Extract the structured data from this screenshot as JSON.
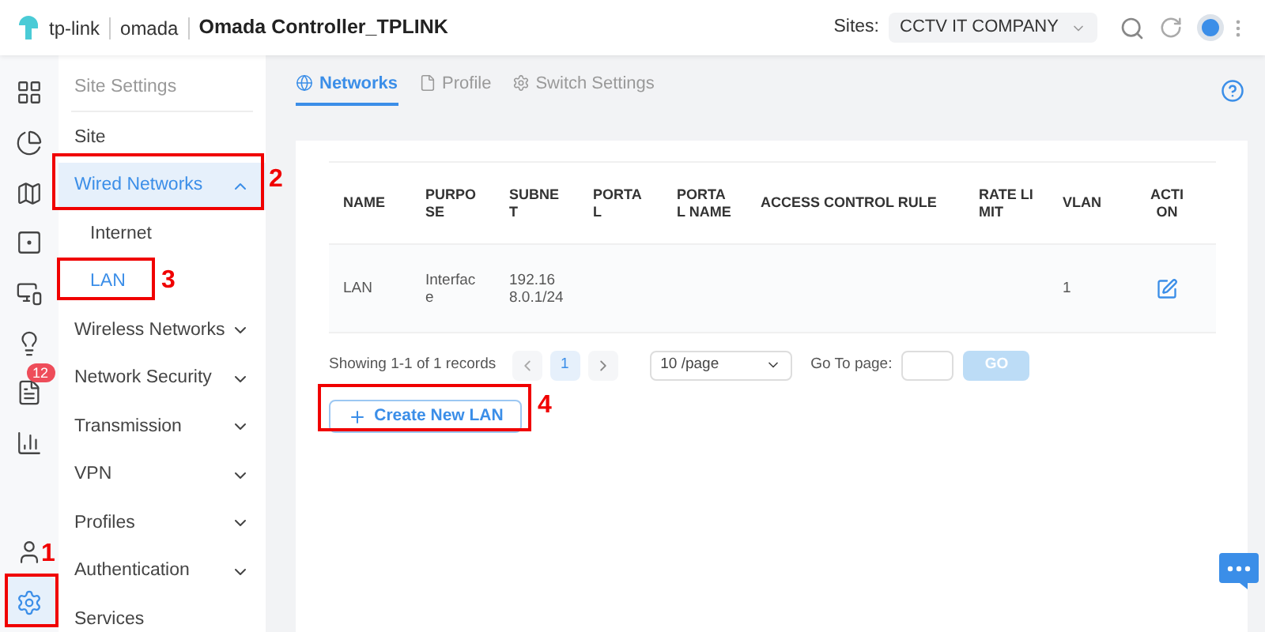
{
  "header": {
    "brand": "tp-link",
    "product": "omada",
    "title": "Omada Controller_TPLINK",
    "sites_label": "Sites:",
    "site": "CCTV IT COMPANY"
  },
  "rail": [
    {
      "kind": "apps",
      "selected": false
    },
    {
      "kind": "chart",
      "selected": false
    },
    {
      "kind": "map",
      "selected": false
    },
    {
      "kind": "device",
      "selected": false
    },
    {
      "kind": "clients",
      "selected": false
    },
    {
      "kind": "insight",
      "selected": false
    },
    {
      "kind": "log",
      "selected": false,
      "badge": "12"
    },
    {
      "kind": "stats",
      "selected": false
    },
    {
      "kind": "account",
      "selected": false
    },
    {
      "kind": "settings",
      "selected": true
    }
  ],
  "sidebar": {
    "heading": "Site Settings",
    "items": [
      {
        "label": "Site",
        "selected": false
      },
      {
        "label": "Wired Networks",
        "selected": true,
        "expanded": true,
        "children": [
          {
            "label": "Internet",
            "selected": false
          },
          {
            "label": "LAN",
            "selected": true
          }
        ]
      },
      {
        "label": "Wireless Networks",
        "selected": false,
        "expanded": false
      },
      {
        "label": "Network Security",
        "selected": false,
        "expanded": false
      },
      {
        "label": "Transmission",
        "selected": false,
        "expanded": false
      },
      {
        "label": "VPN",
        "selected": false,
        "expanded": false
      },
      {
        "label": "Profiles",
        "selected": false,
        "expanded": false
      },
      {
        "label": "Authentication",
        "selected": false,
        "expanded": false
      },
      {
        "label": "Services",
        "selected": false
      }
    ]
  },
  "tabs": [
    {
      "label": "Networks",
      "kind": "globe",
      "selected": true
    },
    {
      "label": "Profile",
      "kind": "doc",
      "selected": false
    },
    {
      "label": "Switch Settings",
      "kind": "gear",
      "selected": false
    }
  ],
  "table": {
    "columns": [
      "NAME",
      "PURPOSE",
      "SUBNET",
      "PORTAL",
      "PORTAL NAME",
      "ACCESS CONTROL RULE",
      "RATE LIMIT",
      "VLAN",
      "ACTION"
    ],
    "rows": [
      {
        "name": "LAN",
        "purpose": "Interface",
        "subnet": "192.168.0.1/24",
        "vlan": "1"
      }
    ]
  },
  "pagination": {
    "summary": "Showing 1-1 of 1 records",
    "pages": [
      {
        "label": "1",
        "selected": true
      }
    ],
    "page_size": "10 /page",
    "goto_label": "Go To page:",
    "go": "GO",
    "go_disabled": true
  },
  "create_button": "Create New LAN",
  "annotations": [
    {
      "label": "1"
    },
    {
      "label": "2"
    },
    {
      "label": "3"
    },
    {
      "label": "4"
    }
  ]
}
